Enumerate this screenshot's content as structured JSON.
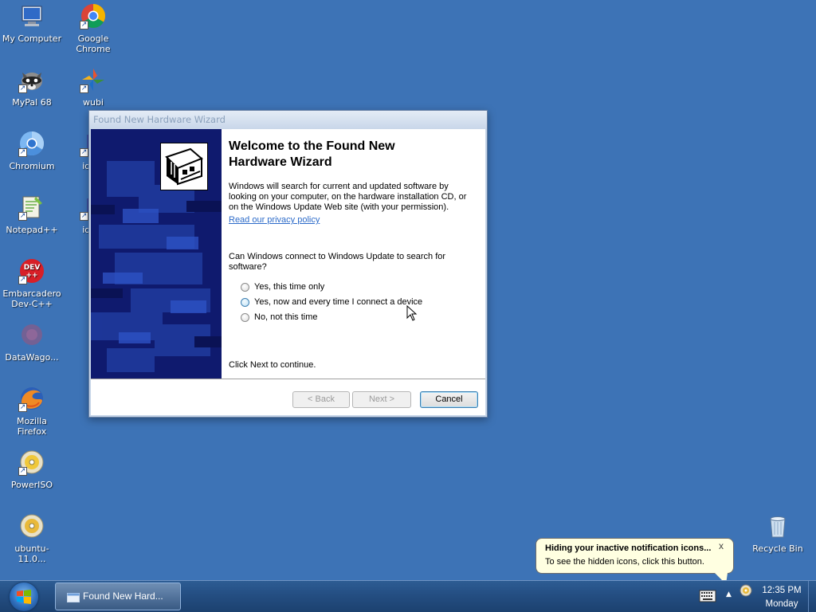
{
  "desktop": {
    "icons": [
      {
        "label": "My Computer",
        "icon": "computer-icon",
        "shortcut": false
      },
      {
        "label": "Google\nChrome",
        "icon": "chrome-icon",
        "shortcut": true
      },
      {
        "label": "MyPal 68",
        "icon": "raccoon-icon",
        "shortcut": true
      },
      {
        "label": "wubi",
        "icon": "wubi-icon",
        "shortcut": true
      },
      {
        "label": "Chromium",
        "icon": "chromium-icon",
        "shortcut": true
      },
      {
        "label": "idma",
        "icon": "idm-icon",
        "shortcut": true
      },
      {
        "label": "Notepad++",
        "icon": "notepad-icon",
        "shortcut": true
      },
      {
        "label": "idma",
        "icon": "idm-icon",
        "shortcut": true
      },
      {
        "label": "Embarcadero\nDev-C++",
        "icon": "devcpp-icon",
        "shortcut": true
      },
      {
        "label": "DataWago...",
        "icon": "datawagon-icon",
        "shortcut": false
      },
      {
        "label": "Mozilla\nFirefox",
        "icon": "firefox-icon",
        "shortcut": true
      },
      {
        "label": "PowerISO",
        "icon": "poweriso-icon",
        "shortcut": true
      },
      {
        "label": "ubuntu-11.0...",
        "icon": "disc-icon",
        "shortcut": false
      },
      {
        "label": "Recycle Bin",
        "icon": "recycle-bin-icon",
        "shortcut": false
      }
    ]
  },
  "wizard": {
    "title": "Found New Hardware Wizard",
    "heading": "Welcome to the Found New\nHardware Wizard",
    "intro": "Windows will search for current and updated software by looking on your computer, on the hardware installation CD, or on the Windows Update Web site (with your permission).",
    "privacy_link": "Read our privacy policy",
    "question": "Can Windows connect to Windows Update to search for software?",
    "options": [
      "Yes, this time only",
      "Yes, now and every time I connect a device",
      "No, not this time"
    ],
    "continue_text": "Click Next to continue.",
    "buttons": {
      "back": "< Back",
      "next": "Next >",
      "cancel": "Cancel"
    },
    "icon": "hardware-card-icon"
  },
  "notification": {
    "title": "Hiding your inactive notification icons...",
    "text": "To see the hidden icons, click this button.",
    "close": "x"
  },
  "taskbar": {
    "task_label": "Found New Hard...",
    "clock_time": "12:35 PM",
    "clock_day": "Monday",
    "tray_arrow": "▲"
  }
}
